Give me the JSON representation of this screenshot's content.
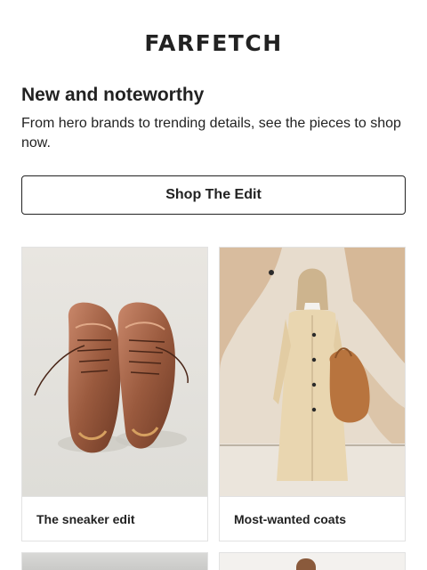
{
  "brand": {
    "logo_text": "FARFETCH"
  },
  "hero": {
    "headline": "New and noteworthy",
    "intro": "From hero brands to trending details, see the pieces to shop now.",
    "cta_label": "Shop The Edit"
  },
  "cards": [
    {
      "caption": "The sneaker edit",
      "image": "bronze-satin-sneakers"
    },
    {
      "caption": "Most-wanted coats",
      "image": "woman-in-cream-coat-with-tan-bag"
    },
    {
      "caption": "",
      "image": "partial-image"
    },
    {
      "caption": "",
      "image": "partial-image"
    }
  ],
  "colors": {
    "text": "#222222",
    "border": "#e2e2e2",
    "background": "#ffffff"
  }
}
